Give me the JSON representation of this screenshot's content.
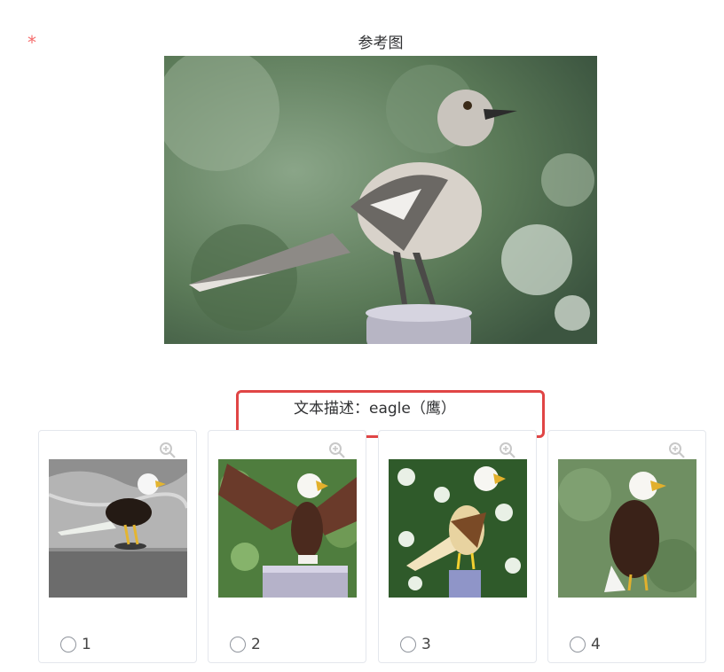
{
  "required_mark": "*",
  "reference": {
    "title": "参考图"
  },
  "caption": {
    "text": "文本描述：eagle（鹰）",
    "highlight_color": "#e04545"
  },
  "options": [
    {
      "label": "1",
      "selected": false
    },
    {
      "label": "2",
      "selected": false
    },
    {
      "label": "3",
      "selected": false
    },
    {
      "label": "4",
      "selected": false
    }
  ],
  "icons": {
    "zoom": "zoom-in-icon",
    "radio": "radio-icon"
  }
}
